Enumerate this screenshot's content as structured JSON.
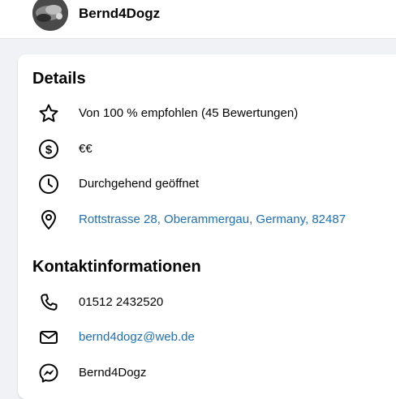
{
  "header": {
    "profile_name": "Bernd4Dogz"
  },
  "details": {
    "title": "Details",
    "rating": {
      "icon": "star-icon",
      "text": "Von 100 % empfohlen (45 Bewertungen)"
    },
    "price": {
      "icon": "dollar-circle-icon",
      "text": "€€"
    },
    "hours": {
      "icon": "clock-icon",
      "text": "Durchgehend geöffnet"
    },
    "address": {
      "icon": "location-pin-icon",
      "text": "Rottstrasse 28, Oberammergau, Germany, 82487"
    }
  },
  "contact": {
    "title": "Kontaktinformationen",
    "phone": {
      "icon": "phone-icon",
      "text": "01512 2432520"
    },
    "email": {
      "icon": "mail-icon",
      "text": "bernd4dogz@web.de"
    },
    "messenger": {
      "icon": "messenger-icon",
      "text": "Bernd4Dogz"
    }
  },
  "colors": {
    "link": "#1e6fb6",
    "background": "#f0f2f5",
    "card": "#ffffff"
  }
}
